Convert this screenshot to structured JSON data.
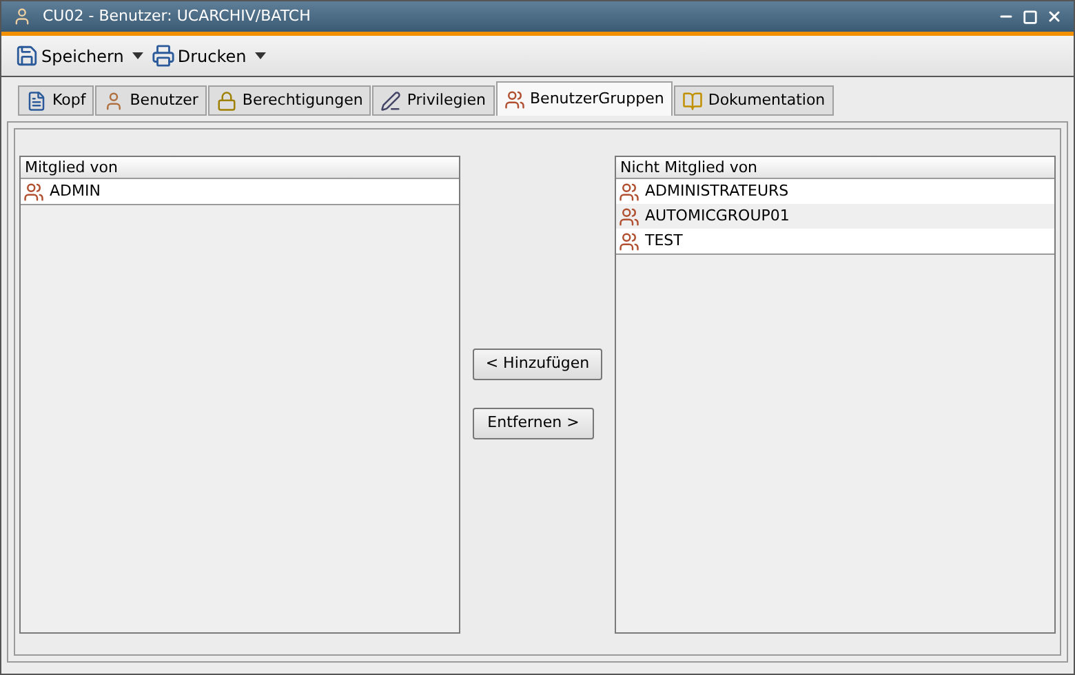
{
  "window": {
    "title": "CU02 - Benutzer: UCARCHIV/BATCH"
  },
  "toolbar": [
    {
      "label": "Speichern",
      "kind": "save"
    },
    {
      "label": "Drucken",
      "kind": "print"
    }
  ],
  "tabs": [
    {
      "label": "Kopf",
      "kind": "info",
      "selected": false
    },
    {
      "label": "Benutzer",
      "kind": "user",
      "selected": false
    },
    {
      "label": "Berechtigungen",
      "kind": "lock",
      "selected": false
    },
    {
      "label": "Privilegien",
      "kind": "pencil",
      "selected": false
    },
    {
      "label": "BenutzerGruppen",
      "kind": "group",
      "selected": true
    },
    {
      "label": "Dokumentation",
      "kind": "book",
      "selected": false
    }
  ],
  "member_of": {
    "header": "Mitglied von",
    "rows": [
      "ADMIN"
    ]
  },
  "not_member_of": {
    "header": "Nicht Mitglied von",
    "rows": [
      "ADMINISTRATEURS",
      "AUTOMICGROUP01",
      "TEST"
    ]
  },
  "buttons": {
    "add": "< Hinzufügen",
    "remove": "Entfernen >"
  }
}
